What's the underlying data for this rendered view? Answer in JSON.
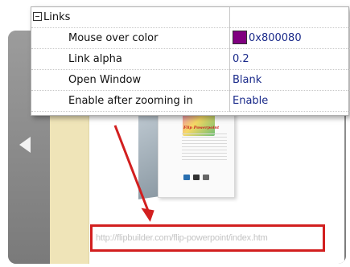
{
  "property_grid": {
    "section_label": "Links",
    "rows": [
      {
        "name": "Mouse over color",
        "value": "0x800080",
        "swatch_color": "#800080"
      },
      {
        "name": "Link alpha",
        "value": "0.2"
      },
      {
        "name": "Open Window",
        "value": "Blank"
      },
      {
        "name": "Enable after zooming in",
        "value": "Enable"
      }
    ]
  },
  "viewer": {
    "box_title": "Flip Powerpoint",
    "url_text": "http://flipbuilder.com/flip-powerpoint/index.htm"
  },
  "colors": {
    "highlight": "#d21f1f",
    "value_text": "#1a2a8a"
  }
}
